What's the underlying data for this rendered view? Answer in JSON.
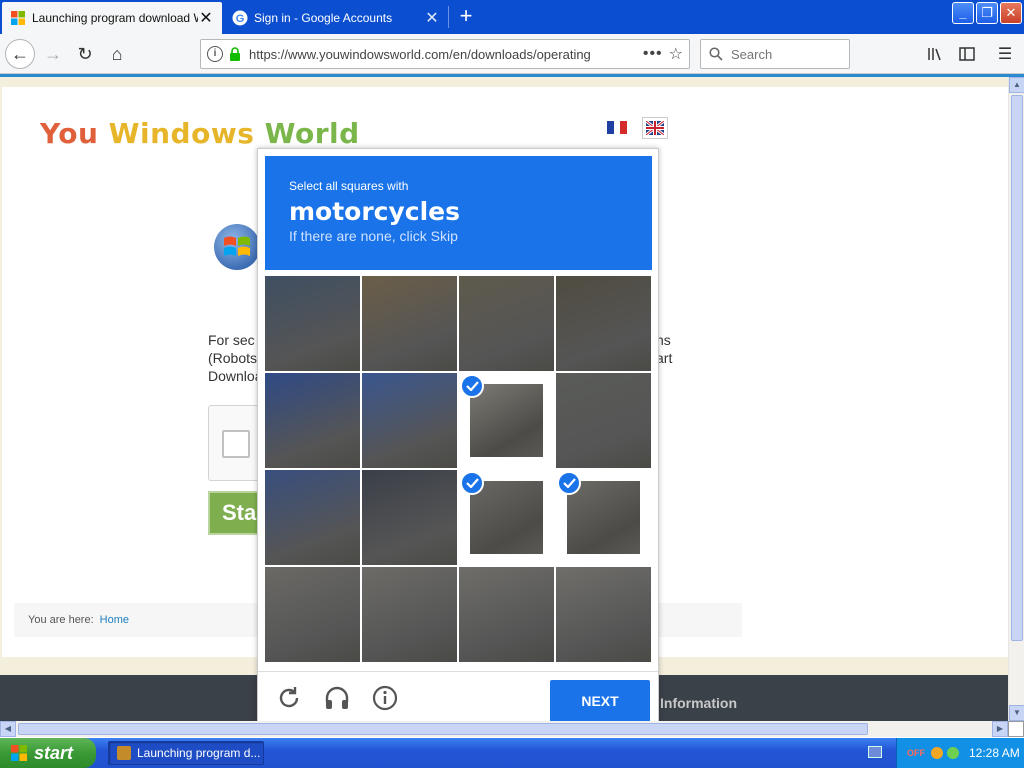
{
  "browser": {
    "tabs": [
      {
        "title": "Launching program download Win",
        "active": true,
        "icon": "windows-logo-icon"
      },
      {
        "title": "Sign in - Google Accounts",
        "active": false,
        "icon": "google-g-icon"
      }
    ],
    "url": "https://www.youwindowsworld.com/en/downloads/operating",
    "search_placeholder": "Search"
  },
  "site": {
    "logo": {
      "word1": "You",
      "word2": "Windows",
      "word3": "World"
    },
    "intro_left": [
      "For  sec",
      "(Robots",
      "Downloa"
    ],
    "intro_right": [
      "ns",
      "art"
    ],
    "start_label": "Star",
    "breadcrumb_label": "You are here:",
    "breadcrumb_link": "Home",
    "footer_info": "Information"
  },
  "captcha": {
    "instruction": "Select all squares with",
    "target": "motorcycles",
    "hint": "If there are none, click Skip",
    "selected_tiles": [
      6,
      10,
      11
    ],
    "next_label": "NEXT",
    "footer_icons": [
      "reload-icon",
      "headphones-icon",
      "info-icon"
    ],
    "accent_color": "#1a73e8"
  },
  "taskbar": {
    "start_label": "start",
    "task_item": "Launching program d...",
    "tray_status": "OFF",
    "clock": "12:28 AM"
  }
}
